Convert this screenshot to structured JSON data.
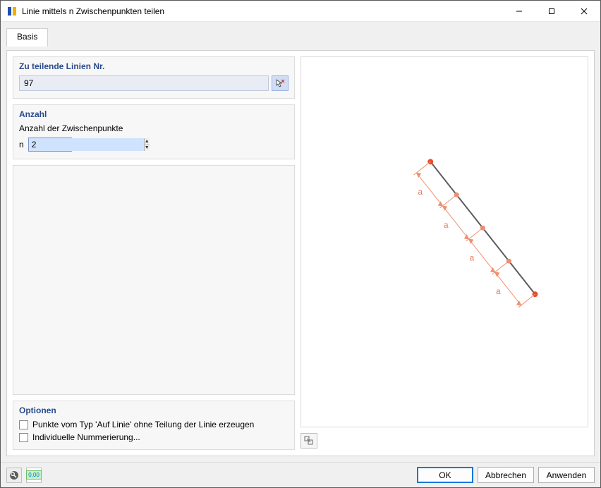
{
  "window": {
    "title": "Linie mittels n Zwischenpunkten teilen"
  },
  "tabs": {
    "basis": "Basis"
  },
  "lines_section": {
    "title": "Zu teilende Linien Nr.",
    "value": "97"
  },
  "count_section": {
    "title": "Anzahl",
    "subtitle": "Anzahl der Zwischenpunkte",
    "n_label": "n",
    "n_value": "2"
  },
  "options_section": {
    "title": "Optionen",
    "opt1": "Punkte vom Typ 'Auf Linie' ohne Teilung der Linie erzeugen",
    "opt2": "Individuelle Nummerierung..."
  },
  "preview": {
    "segment_label": "a"
  },
  "buttons": {
    "ok": "OK",
    "cancel": "Abbrechen",
    "apply": "Anwenden"
  },
  "footer_icons": {
    "help": "help-icon",
    "units": "0,00"
  }
}
